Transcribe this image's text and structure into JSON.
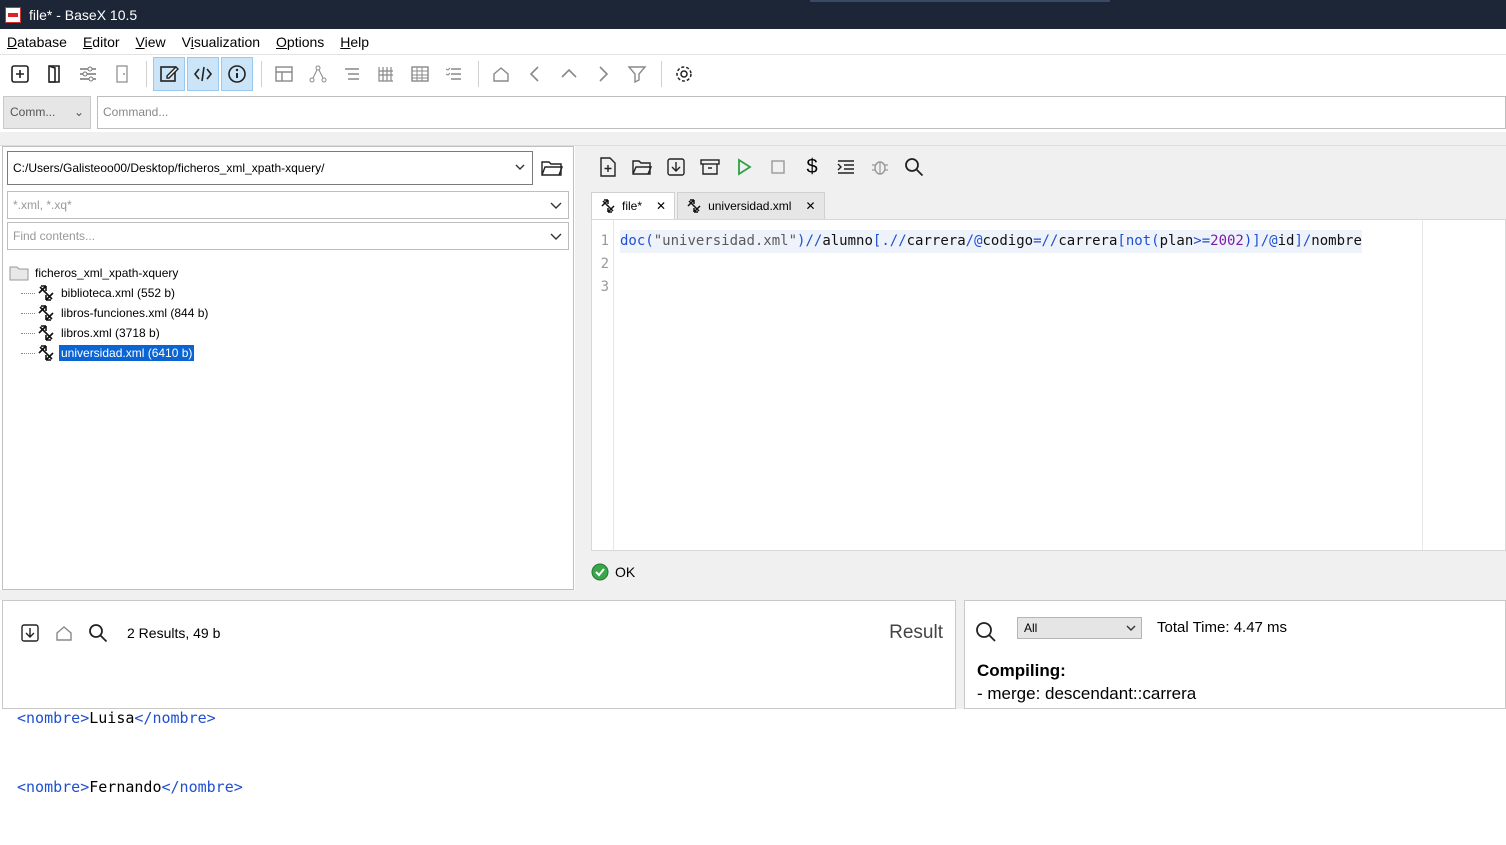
{
  "window": {
    "title": "file* - BaseX 10.5"
  },
  "menu": [
    {
      "label": "Database",
      "mnemonic": "D",
      "rest": "atabase"
    },
    {
      "label": "Editor",
      "mnemonic": "E",
      "rest": "ditor"
    },
    {
      "label": "View",
      "mnemonic": "V",
      "rest": "iew"
    },
    {
      "label": "Visualization",
      "mnemonic": "",
      "pre": "V",
      "mid": "i",
      "post": "sualization"
    },
    {
      "label": "Options",
      "mnemonic": "O",
      "rest": "ptions"
    },
    {
      "label": "Help",
      "mnemonic": "H",
      "rest": "elp"
    }
  ],
  "command": {
    "mode": "Comm...",
    "placeholder": "Command..."
  },
  "browser": {
    "path": "C:/Users/Galisteoo00/Desktop/ficheros_xml_xpath-xquery/",
    "filter_placeholder": "*.xml, *.xq*",
    "find_placeholder": "Find contents...",
    "root": "ficheros_xml_xpath-xquery",
    "files": [
      {
        "label": "biblioteca.xml (552 b)",
        "selected": false
      },
      {
        "label": "libros-funciones.xml (844 b)",
        "selected": false
      },
      {
        "label": "libros.xml (3718 b)",
        "selected": false
      },
      {
        "label": "universidad.xml (6410 b)",
        "selected": true
      }
    ]
  },
  "editor": {
    "tabs": [
      {
        "label": "file*",
        "active": true
      },
      {
        "label": "universidad.xml",
        "active": false
      }
    ],
    "line_numbers": [
      "1",
      "2",
      "3"
    ],
    "code": "doc(\"universidad.xml\")//alumno[.//carrera/@codigo=//carrera[not(plan>=2002)]/@id]/nombre",
    "status": "OK"
  },
  "result": {
    "count": "2 Results, 49 b",
    "title": "Result",
    "items": [
      {
        "open": "<nombre>",
        "text": "Luisa",
        "close": "</nombre>"
      },
      {
        "open": "<nombre>",
        "text": "Fernando",
        "close": "</nombre>"
      }
    ]
  },
  "info": {
    "filter": "All",
    "time": "Total Time: 4.47 ms",
    "heading": "Compiling:",
    "line1": "- merge: descendant::carrera"
  },
  "colors": {
    "titlebar": "#1c2636",
    "selection": "#0a64d2",
    "keyword": "#1f4fd0",
    "number": "#7b1fa2",
    "ok": "#3aa64a"
  }
}
